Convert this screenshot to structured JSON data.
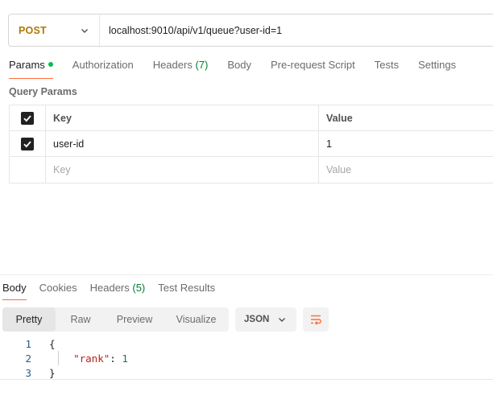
{
  "request": {
    "method": "POST",
    "url": "localhost:9010/api/v1/queue?user-id=1"
  },
  "request_tabs": [
    {
      "label": "Params",
      "count": "",
      "active": true,
      "dot": true
    },
    {
      "label": "Authorization",
      "count": "",
      "active": false
    },
    {
      "label": "Headers",
      "count": "(7)",
      "active": false
    },
    {
      "label": "Body",
      "count": "",
      "active": false
    },
    {
      "label": "Pre-request Script",
      "count": "",
      "active": false
    },
    {
      "label": "Tests",
      "count": "",
      "active": false
    },
    {
      "label": "Settings",
      "count": "",
      "active": false
    }
  ],
  "query_params": {
    "title": "Query Params",
    "header": {
      "key": "Key",
      "value": "Value"
    },
    "rows": [
      {
        "checked": true,
        "key": "user-id",
        "value": "1"
      }
    ],
    "placeholder": {
      "key": "Key",
      "value": "Value"
    }
  },
  "response_tabs": [
    {
      "label": "Body",
      "count": "",
      "active": true
    },
    {
      "label": "Cookies",
      "count": "",
      "active": false
    },
    {
      "label": "Headers",
      "count": "(5)",
      "active": false
    },
    {
      "label": "Test Results",
      "count": "",
      "active": false
    }
  ],
  "view_modes": [
    "Pretty",
    "Raw",
    "Preview",
    "Visualize"
  ],
  "active_view": "Pretty",
  "format": "JSON",
  "code_lines": [
    {
      "num": "1",
      "text": "{"
    },
    {
      "num": "2",
      "key": "\"rank\"",
      "sep": ": ",
      "val": "1"
    },
    {
      "num": "3",
      "text": "}"
    }
  ],
  "colors": {
    "accent": "#ff6c37",
    "method": "#ad7a03",
    "status_dot": "#0cbb52"
  }
}
